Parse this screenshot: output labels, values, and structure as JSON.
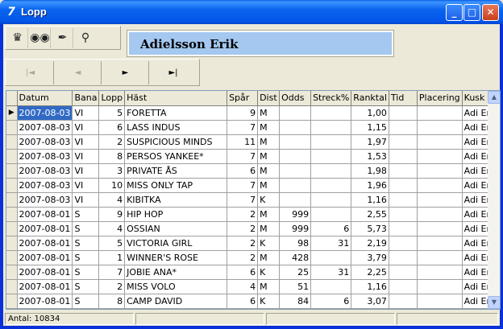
{
  "window": {
    "title": "Lopp"
  },
  "toolbar": {
    "icons": [
      "rules-icon",
      "binoculars-icon",
      "pen-icon",
      "key-icon"
    ]
  },
  "header": {
    "name": "Adielsson Erik"
  },
  "navigation": {
    "first_label": "|◄",
    "prev_label": "◄",
    "next_label": "►",
    "last_label": "►|"
  },
  "table": {
    "columns": [
      "Datum",
      "Bana",
      "Lopp",
      "Häst",
      "Spår",
      "Dist",
      "Odds",
      "Streck%",
      "Ranktal",
      "Tid",
      "Placering",
      "Kusk"
    ],
    "rows": [
      [
        "2007-08-03",
        "VI",
        "5",
        "FORETTA",
        "9",
        "M",
        "",
        "",
        "1,00",
        "",
        "",
        "Adi Er"
      ],
      [
        "2007-08-03",
        "VI",
        "6",
        "LASS INDUS",
        "7",
        "M",
        "",
        "",
        "1,15",
        "",
        "",
        "Adi Er"
      ],
      [
        "2007-08-03",
        "VI",
        "2",
        "SUSPICIOUS MINDS",
        "11",
        "M",
        "",
        "",
        "1,97",
        "",
        "",
        "Adi Er"
      ],
      [
        "2007-08-03",
        "VI",
        "8",
        "PERSOS YANKEE*",
        "7",
        "M",
        "",
        "",
        "1,53",
        "",
        "",
        "Adi Er"
      ],
      [
        "2007-08-03",
        "VI",
        "3",
        "PRIVATE ÅS",
        "6",
        "M",
        "",
        "",
        "1,98",
        "",
        "",
        "Adi Er"
      ],
      [
        "2007-08-03",
        "VI",
        "10",
        "MISS ONLY TAP",
        "7",
        "M",
        "",
        "",
        "1,96",
        "",
        "",
        "Adi Er"
      ],
      [
        "2007-08-03",
        "VI",
        "4",
        "KIBITKA",
        "7",
        "K",
        "",
        "",
        "1,16",
        "",
        "",
        "Adi Er"
      ],
      [
        "2007-08-01",
        "S",
        "9",
        "HIP HOP",
        "2",
        "M",
        "999",
        "",
        "2,55",
        "",
        "",
        "Adi Er"
      ],
      [
        "2007-08-01",
        "S",
        "4",
        "OSSIAN",
        "2",
        "M",
        "999",
        "6",
        "5,73",
        "",
        "",
        "Adi Er"
      ],
      [
        "2007-08-01",
        "S",
        "5",
        "VICTORIA GIRL",
        "2",
        "K",
        "98",
        "31",
        "2,19",
        "",
        "",
        "Adi Er"
      ],
      [
        "2007-08-01",
        "S",
        "1",
        "WINNER'S ROSE",
        "2",
        "M",
        "428",
        "",
        "3,79",
        "",
        "",
        "Adi Er"
      ],
      [
        "2007-08-01",
        "S",
        "7",
        "JOBIE ANA*",
        "6",
        "K",
        "25",
        "31",
        "2,25",
        "",
        "",
        "Adi Er"
      ],
      [
        "2007-08-01",
        "S",
        "2",
        "MISS VOLO",
        "4",
        "M",
        "51",
        "",
        "1,16",
        "",
        "",
        "Adi Er"
      ],
      [
        "2007-08-01",
        "S",
        "8",
        "CAMP DAVID",
        "6",
        "K",
        "84",
        "6",
        "3,07",
        "",
        "",
        "Adi Er"
      ]
    ],
    "selected_row": 0,
    "selection_color": "#316ac5"
  },
  "status": {
    "count": "Antal: 10834"
  }
}
